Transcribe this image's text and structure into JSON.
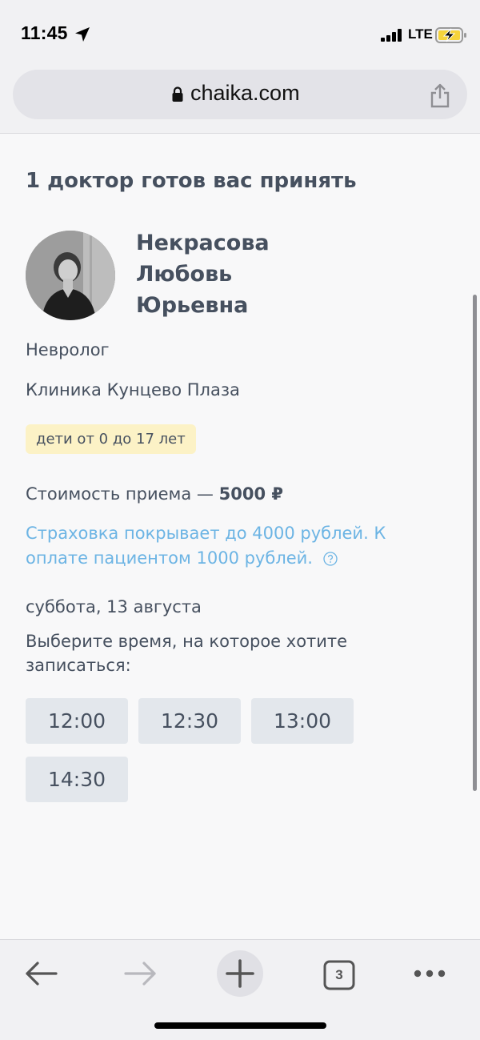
{
  "status_bar": {
    "time": "11:45",
    "network": "LTE",
    "icons": [
      "location-arrow-icon",
      "signal-icon",
      "battery-charging-icon"
    ]
  },
  "browser": {
    "url": "chaika.com",
    "icons": [
      "lock-icon",
      "share-icon"
    ]
  },
  "page": {
    "heading": "1 доктор готов вас принять",
    "doctor": {
      "name": "Некрасова\nЛюбовь\nЮрьевна",
      "specialty": "Невролог",
      "clinic": "Клиника Кунцево Плаза",
      "age_badge": "дети от 0 до 17 лет"
    },
    "price": {
      "label": "Стоимость приема — ",
      "value": "5000 ₽"
    },
    "insurance_text": "Страховка покрывает до 4000 рублей. К оплате пациентом 1000 рублей.",
    "date": "суббота, 13 августа",
    "instruction": "Выберите время, на которое хотите записаться:",
    "time_slots": [
      "12:00",
      "12:30",
      "13:00",
      "14:30"
    ]
  },
  "toolbar": {
    "tabs_count": "3",
    "icons": [
      "back-arrow-icon",
      "forward-arrow-icon",
      "new-tab-plus-icon",
      "tabs-icon",
      "more-icon"
    ]
  },
  "colors": {
    "text": "#46505f",
    "link": "#6cb4e4",
    "badge_bg": "#fcf2c6",
    "slot_bg": "#e3e7ec"
  }
}
